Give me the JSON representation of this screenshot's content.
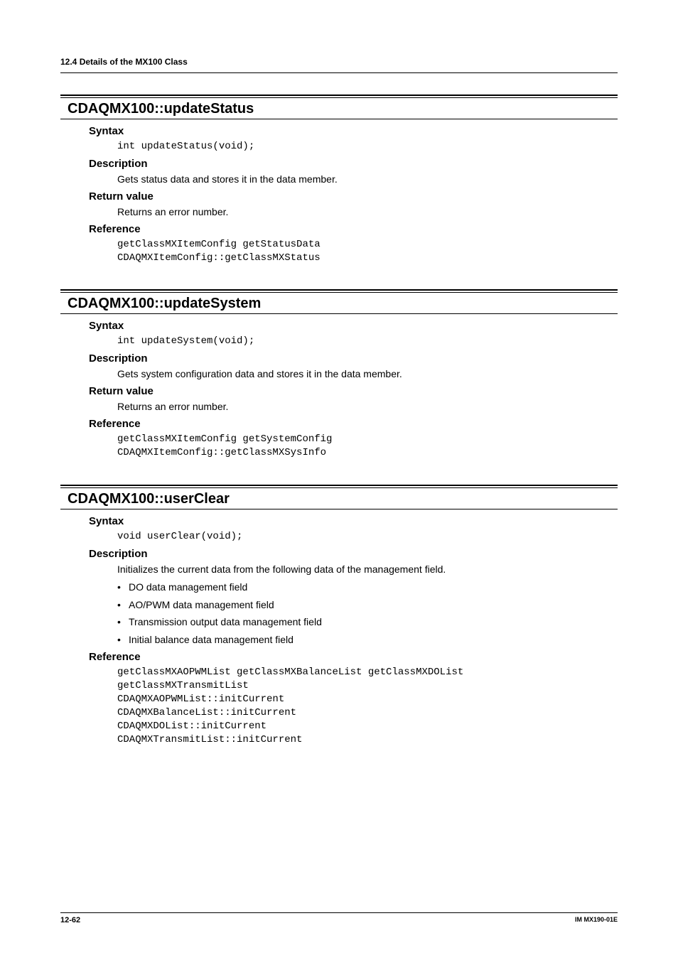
{
  "header": {
    "title": "12.4  Details of the MX100 Class"
  },
  "sections": [
    {
      "title": "CDAQMX100::updateStatus",
      "blocks": [
        {
          "heading": "Syntax",
          "type": "code",
          "lines": [
            "int updateStatus(void);"
          ]
        },
        {
          "heading": "Description",
          "type": "text",
          "lines": [
            "Gets status data and stores it in the data member."
          ]
        },
        {
          "heading": "Return value",
          "type": "text",
          "lines": [
            "Returns an error number."
          ]
        },
        {
          "heading": "Reference",
          "type": "code",
          "lines": [
            "getClassMXItemConfig getStatusData",
            "CDAQMXItemConfig::getClassMXStatus"
          ]
        }
      ]
    },
    {
      "title": "CDAQMX100::updateSystem",
      "blocks": [
        {
          "heading": "Syntax",
          "type": "code",
          "lines": [
            "int updateSystem(void);"
          ]
        },
        {
          "heading": "Description",
          "type": "text",
          "lines": [
            "Gets system configuration data and stores it in the data member."
          ]
        },
        {
          "heading": "Return value",
          "type": "text",
          "lines": [
            "Returns an error number."
          ]
        },
        {
          "heading": "Reference",
          "type": "code",
          "lines": [
            "getClassMXItemConfig getSystemConfig",
            "CDAQMXItemConfig::getClassMXSysInfo"
          ]
        }
      ]
    },
    {
      "title": "CDAQMX100::userClear",
      "blocks": [
        {
          "heading": "Syntax",
          "type": "code",
          "lines": [
            "void userClear(void);"
          ]
        },
        {
          "heading": "Description",
          "type": "text",
          "lines": [
            "Initializes the current data from the following data of the management field."
          ]
        },
        {
          "heading": "",
          "type": "bullets",
          "lines": [
            "DO data management field",
            "AO/PWM data management field",
            "Transmission output data management field",
            "Initial balance data management field"
          ]
        },
        {
          "heading": "Reference",
          "type": "code",
          "lines": [
            "getClassMXAOPWMList getClassMXBalanceList getClassMXDOList",
            "getClassMXTransmitList",
            "CDAQMXAOPWMList::initCurrent",
            "CDAQMXBalanceList::initCurrent",
            "CDAQMXDOList::initCurrent",
            "CDAQMXTransmitList::initCurrent"
          ]
        }
      ]
    }
  ],
  "footer": {
    "page": "12-62",
    "docid": "IM MX190-01E"
  }
}
